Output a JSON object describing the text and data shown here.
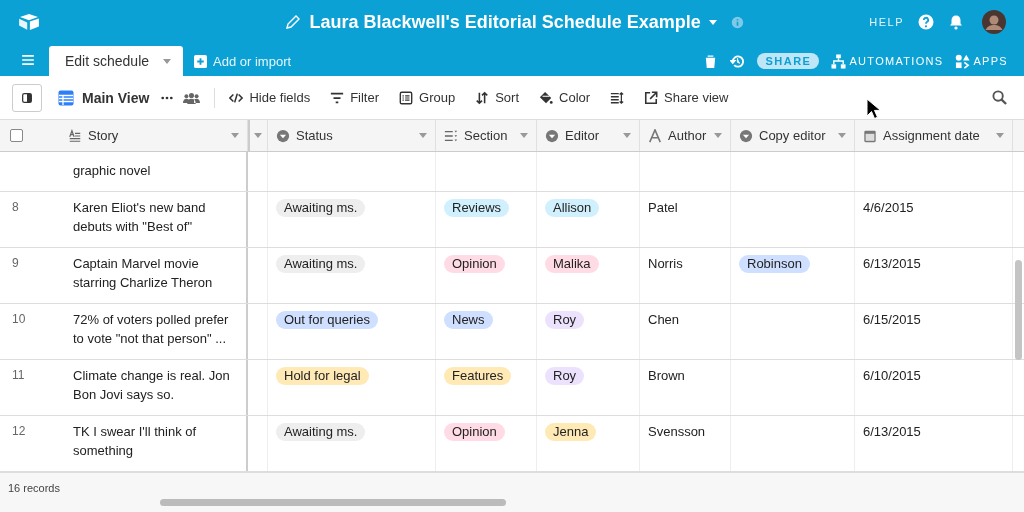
{
  "app_bar": {
    "title": "Laura Blackwell's Editorial Schedule Example",
    "help": "HELP"
  },
  "tabs": [
    {
      "label": "Edit schedule",
      "selected": true
    }
  ],
  "add_import": "Add or import",
  "actions": [
    {
      "kind": "trash"
    },
    {
      "kind": "history"
    },
    {
      "kind": "share",
      "label": "SHARE"
    },
    {
      "kind": "automations",
      "label": "AUTOMATIONS"
    },
    {
      "kind": "apps",
      "label": "APPS"
    }
  ],
  "view": {
    "name": "Main View"
  },
  "toolbar": [
    {
      "kind": "hide",
      "label": "Hide fields"
    },
    {
      "kind": "filter",
      "label": "Filter"
    },
    {
      "kind": "group",
      "label": "Group"
    },
    {
      "kind": "sort",
      "label": "Sort"
    },
    {
      "kind": "color",
      "label": "Color"
    },
    {
      "kind": "height"
    },
    {
      "kind": "shareview",
      "label": "Share view"
    }
  ],
  "select_all": {
    "checked": false
  },
  "columns": [
    {
      "label": "Story",
      "kind": "text"
    },
    {
      "label": "Status",
      "kind": "select"
    },
    {
      "label": "Section",
      "kind": "multi"
    },
    {
      "label": "Editor",
      "kind": "select"
    },
    {
      "label": "Author",
      "kind": "author"
    },
    {
      "label": "Copy editor",
      "kind": "select"
    },
    {
      "label": "Assignment date",
      "kind": "date"
    }
  ],
  "rows": [
    {
      "partial": true,
      "story": "graphic novel"
    },
    {
      "partial": false,
      "number": "8",
      "story": "Karen Eliot's new band debuts with \"Best of\"",
      "status": {
        "text": "Awaiting ms.",
        "color": "#eeeeee"
      },
      "section": {
        "text": "Reviews",
        "color": "#d0f0fd"
      },
      "editor": {
        "text": "Allison",
        "color": "#d0f0fd"
      },
      "author": "Patel",
      "date": "4/6/2015"
    },
    {
      "partial": false,
      "number": "9",
      "story": "Captain Marvel movie starring Charlize Theron",
      "status": {
        "text": "Awaiting ms.",
        "color": "#eeeeee"
      },
      "section": {
        "text": "Opinion",
        "color": "#ffdce5"
      },
      "editor": {
        "text": "Malika",
        "color": "#ffdce5"
      },
      "author": "Norris",
      "copy_editor": {
        "text": "Robinson",
        "color": "#cfdfff"
      },
      "date": "6/13/2015"
    },
    {
      "partial": false,
      "number": "10",
      "story": "72% of voters polled prefer to vote \"not that person\" ...",
      "status": {
        "text": "Out for queries",
        "color": "#cfdfff"
      },
      "section": {
        "text": "News",
        "color": "#cfdfff"
      },
      "editor": {
        "text": "Roy",
        "color": "#ede2fe"
      },
      "author": "Chen",
      "date": "6/15/2015"
    },
    {
      "partial": false,
      "number": "11",
      "story": "Climate change is real. Jon Bon Jovi says so.",
      "status": {
        "text": "Hold for legal",
        "color": "#ffeab6"
      },
      "section": {
        "text": "Features",
        "color": "#ffeab6"
      },
      "editor": {
        "text": "Roy",
        "color": "#ede2fe"
      },
      "author": "Brown",
      "date": "6/10/2015"
    },
    {
      "partial": false,
      "number": "12",
      "story": "TK I swear I'll think of something",
      "status": {
        "text": "Awaiting ms.",
        "color": "#eeeeee"
      },
      "section": {
        "text": "Opinion",
        "color": "#ffdce5"
      },
      "editor": {
        "text": "Jenna",
        "color": "#ffeab6"
      },
      "author": "Svensson",
      "date": "6/13/2015"
    }
  ],
  "footer": {
    "records": "16 records"
  }
}
